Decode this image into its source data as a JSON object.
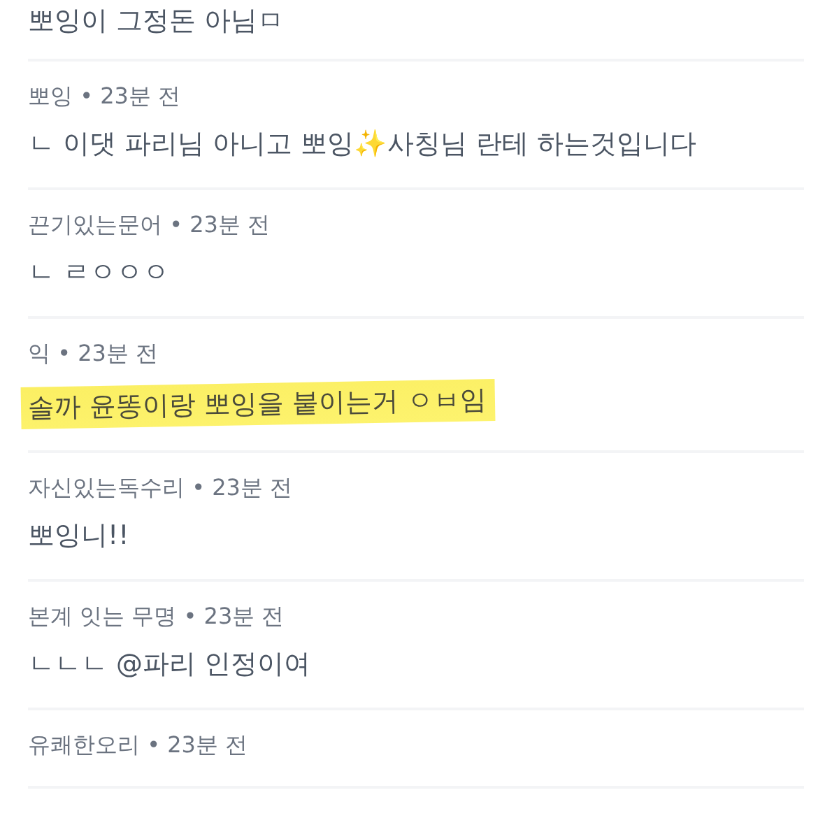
{
  "comments": [
    {
      "body": "뽀잉이 그정돈 아님ㅁ",
      "highlighted": false
    },
    {
      "meta": "뽀잉 • 23분 전",
      "body": "ㄴ 이댓 파리님 아니고 뽀잉✨사칭님 란테 하는것입니다",
      "highlighted": false
    },
    {
      "meta": "끈기있는문어 • 23분 전",
      "body": "ㄴ ㄹㅇㅇㅇ",
      "highlighted": false
    },
    {
      "meta": "익 • 23분 전",
      "body": "솔까 윤똥이랑 뽀잉을 붙이는거 ㅇㅂ임",
      "highlighted": true
    },
    {
      "meta": "자신있는독수리 • 23분 전",
      "body": "뽀잉니!!",
      "highlighted": false
    },
    {
      "meta": "본계 잇는 무명 • 23분 전",
      "body": "ㄴㄴㄴ @파리 인정이여",
      "highlighted": false
    },
    {
      "meta": "유쾌한오리 • 23분 전"
    }
  ]
}
